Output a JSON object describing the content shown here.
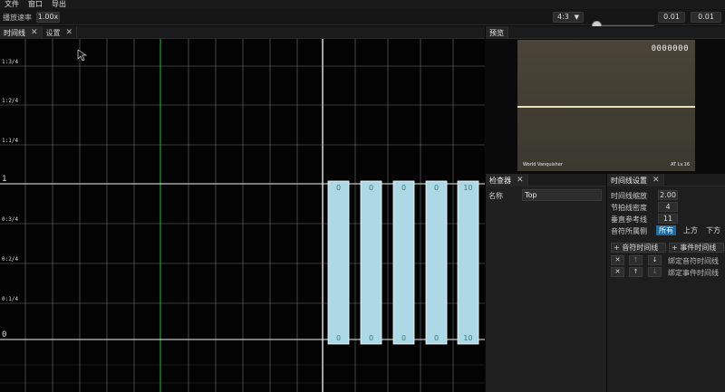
{
  "menu": [
    "文件",
    "窗口",
    "导出"
  ],
  "toolbar": {
    "rate_label": "播放速率",
    "rate_value": "1.00x",
    "aspect_value": "4:3",
    "value_a": "0.01",
    "value_b": "0.01"
  },
  "tabs_left": [
    {
      "label": "时间线",
      "active": true
    },
    {
      "label": "设置",
      "active": false
    }
  ],
  "tab_preview": "预览",
  "tab_inspector": "检查器",
  "tab_timeline_settings": "时间线设置",
  "timeline": {
    "beat_labels": [
      "1:3/4",
      "1:2/4",
      "1:1/4",
      "1",
      "0:3/4",
      "0:2/4",
      "0:1/4",
      "0"
    ],
    "columns": [
      {
        "top": "0",
        "bottom": "0"
      },
      {
        "top": "0",
        "bottom": "0"
      },
      {
        "top": "0",
        "bottom": "0"
      },
      {
        "top": "0",
        "bottom": "0"
      },
      {
        "top": "10",
        "bottom": "10"
      }
    ],
    "colors": {
      "playhead": "#17a317",
      "column_fill": "#add8e6",
      "grid": "#8a8a8a"
    }
  },
  "preview": {
    "score": "0000000",
    "song": "World Vanquisher",
    "level": "AT Lv.16"
  },
  "inspector": {
    "name_label": "名称",
    "name_value": "Top"
  },
  "timeline_settings": {
    "zoom_label": "时间线缩放",
    "zoom_value": "2.00",
    "density_label": "节拍线密度",
    "density_value": "4",
    "vref_label": "垂直参考线",
    "vref_value": "11",
    "side_label": "音符所属侧",
    "side_options": [
      "所有",
      "上方",
      "下方"
    ],
    "add_note_tl": "+ 音符时间线",
    "add_event_tl": "+ 事件时间线",
    "bind_note_tl": "绑定音符时间线",
    "bind_event_tl": "绑定事件时间线"
  }
}
